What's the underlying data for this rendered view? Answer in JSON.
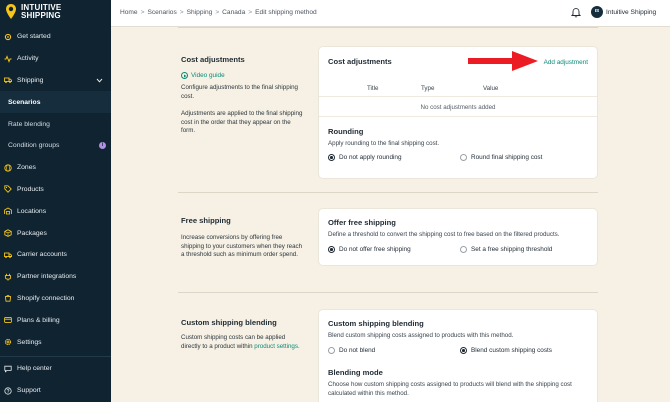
{
  "brand": {
    "logo_line1": "INTUITIVE",
    "logo_line2": "SHIPPING",
    "accent": "#f5c518",
    "sidebar_bg": "#0f2331"
  },
  "sidebar": {
    "items": [
      {
        "label": "Get started",
        "icon": "gear-sparkle-icon"
      },
      {
        "label": "Activity",
        "icon": "activity-icon"
      },
      {
        "label": "Shipping",
        "icon": "truck-icon",
        "expanded": true
      },
      {
        "label": "Scenarios",
        "sub": true,
        "active": true
      },
      {
        "label": "Rate blending",
        "sub": true
      },
      {
        "label": "Condition groups",
        "sub": true,
        "badge": "i"
      },
      {
        "label": "Zones",
        "icon": "globe-icon"
      },
      {
        "label": "Products",
        "icon": "tag-icon"
      },
      {
        "label": "Locations",
        "icon": "warehouse-icon"
      },
      {
        "label": "Packages",
        "icon": "box-icon"
      },
      {
        "label": "Carrier accounts",
        "icon": "truck-icon"
      },
      {
        "label": "Partner integrations",
        "icon": "plug-icon"
      },
      {
        "label": "Shopify connection",
        "icon": "shopify-icon"
      },
      {
        "label": "Plans & billing",
        "icon": "card-icon"
      },
      {
        "label": "Settings",
        "icon": "gear-icon"
      }
    ],
    "footer": [
      {
        "label": "Help center",
        "icon": "chat-icon"
      },
      {
        "label": "Support",
        "icon": "help-icon"
      }
    ]
  },
  "topbar": {
    "breadcrumb": [
      "Home",
      "Scenarios",
      "Shipping",
      "Canada",
      "Edit shipping method"
    ],
    "separator": ">",
    "user_initials": "IS",
    "user_name": "Intuitive Shipping"
  },
  "sections": {
    "cost": {
      "title": "Cost adjustments",
      "video_link": "Video guide",
      "desc1": "Configure adjustments to the final shipping cost.",
      "desc2": "Adjustments are applied to the final shipping cost in the order that they appear on the form.",
      "card_title": "Cost adjustments",
      "add_label": "Add adjustment",
      "columns": [
        "Title",
        "Type",
        "Value"
      ],
      "empty_text": "No cost adjustments added",
      "rounding_title": "Rounding",
      "rounding_desc": "Apply rounding to the final shipping cost.",
      "rounding_options": [
        "Do not apply rounding",
        "Round final shipping cost"
      ],
      "rounding_selected": 0
    },
    "free": {
      "title": "Free shipping",
      "desc": "Increase conversions by offering free shipping to your customers when they reach a threshold such as minimum order spend.",
      "card_title": "Offer free shipping",
      "card_desc": "Define a threshold to convert the shipping cost to free based on the filtered products.",
      "options": [
        "Do not offer free shipping",
        "Set a free shipping threshold"
      ],
      "selected": 0
    },
    "blending": {
      "title": "Custom shipping blending",
      "desc": "Custom shipping costs can be applied directly to a product within",
      "desc_link": "product settings.",
      "card_title": "Custom shipping blending",
      "card_desc": "Blend custom shipping costs assigned to products with this method.",
      "options": [
        "Do not blend",
        "Blend custom shipping costs"
      ],
      "selected": 1,
      "mode_title": "Blending mode",
      "mode_desc": "Choose how custom shipping costs assigned to products will blend with the shipping cost calculated within this method."
    }
  }
}
